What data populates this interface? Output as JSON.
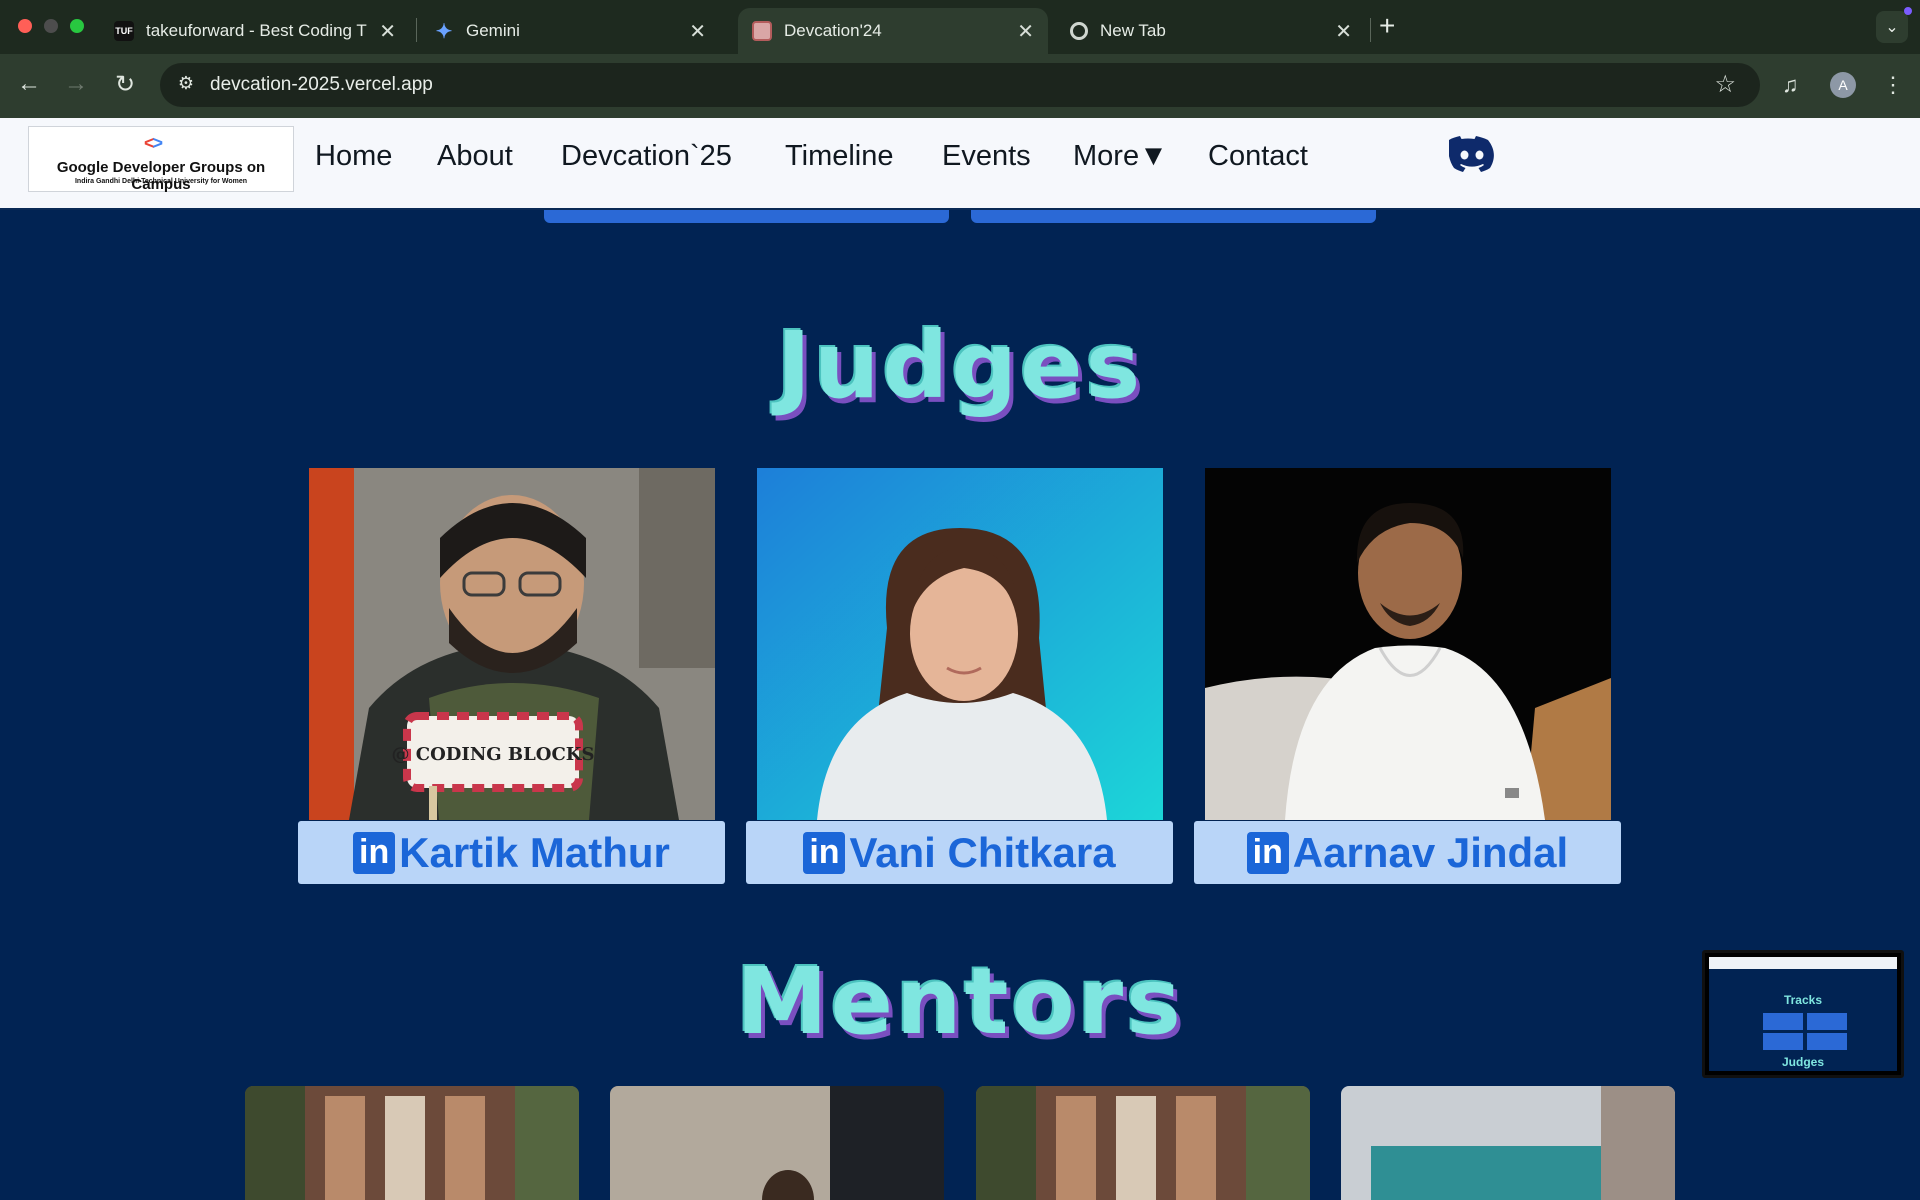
{
  "browser": {
    "tabs": [
      {
        "title": "takeuforward - Best Coding T",
        "favicon": "TUF"
      },
      {
        "title": "Gemini",
        "favicon": "gemini-icon"
      },
      {
        "title": "Devcation'24",
        "favicon": "devcation-icon"
      },
      {
        "title": "New Tab",
        "favicon": "chrome-icon"
      }
    ],
    "url": "devcation-2025.vercel.app",
    "profile_initial": "A"
  },
  "site": {
    "logo": {
      "title": "Google Developer Groups on Campus",
      "subtitle": "Indira Gandhi Delhi Technical University for Women"
    },
    "nav": [
      "Home",
      "About",
      "Devcation`25",
      "Timeline",
      "Events",
      "More▼",
      "Contact"
    ]
  },
  "sections": {
    "judges_title": "Judges",
    "mentors_title": "Mentors"
  },
  "judges": [
    {
      "name": "Kartik Mathur",
      "sign_text": "@ CODING BLOCKS"
    },
    {
      "name": "Vani Chitkara"
    },
    {
      "name": "Aarnav Jindal"
    }
  ],
  "preview": {
    "tracks_title": "Tracks",
    "judges_title": "Judges"
  },
  "colors": {
    "page_bg": "#012353",
    "title_fill": "#7fe6e0",
    "title_shadow": "#7a4fc0",
    "name_bg": "#b9d5f8",
    "linkedin_blue": "#1b66d8"
  }
}
